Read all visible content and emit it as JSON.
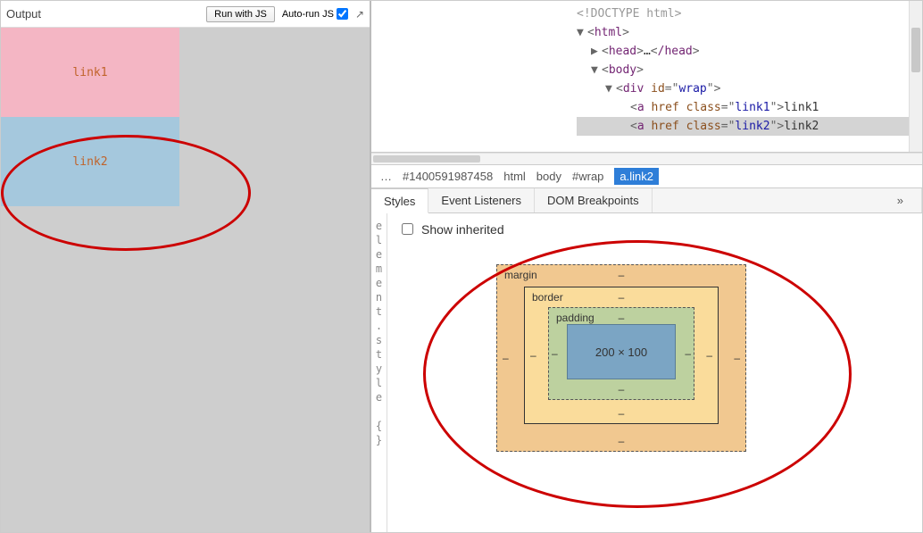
{
  "left": {
    "title": "Output",
    "run_button": "Run with JS",
    "auto_run_label": "Auto-run JS",
    "auto_run_checked": true,
    "links": {
      "link1_text": "link1",
      "link2_text": "link2"
    }
  },
  "dom": {
    "doctype": "<!DOCTYPE html>",
    "html_tag": "html",
    "head_open": "head",
    "head_ellipsis": "…",
    "head_close": "/head",
    "body_tag": "body",
    "div_tag": "div",
    "div_attr_name": "id",
    "div_attr_val": "wrap",
    "a_tag": "a",
    "href_attr": "href",
    "class_attr": "class",
    "link1_class": "link1",
    "link1_text": "link1",
    "link2_class": "link2",
    "link2_text": "link2"
  },
  "breadcrumb": {
    "ellipsis": "…",
    "id": "#1400591987458",
    "html": "html",
    "body": "body",
    "wrap": "#wrap",
    "active": "a.link2"
  },
  "tabs": {
    "styles": "Styles",
    "event_listeners": "Event Listeners",
    "dom_breakpoints": "DOM Breakpoints",
    "more": "»"
  },
  "styles": {
    "show_inherited": "Show inherited",
    "gutter_text": "element.style {}",
    "box_model": {
      "margin_label": "margin",
      "border_label": "border",
      "padding_label": "padding",
      "content": "200 × 100",
      "dash": "–"
    }
  },
  "chart_data": {
    "type": "box-model",
    "content_width": 200,
    "content_height": 100,
    "padding": {
      "top": "-",
      "right": "-",
      "bottom": "-",
      "left": "-"
    },
    "border": {
      "top": "-",
      "right": "-",
      "bottom": "-",
      "left": "-"
    },
    "margin": {
      "top": "-",
      "right": "-",
      "bottom": "-",
      "left": "-"
    }
  }
}
